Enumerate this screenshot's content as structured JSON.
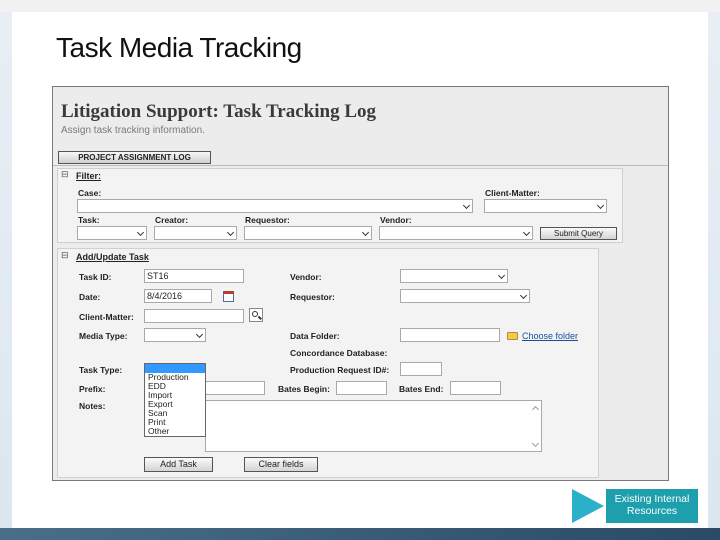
{
  "slide": {
    "title": "Task Media Tracking"
  },
  "app": {
    "title": "Litigation Support: Task Tracking Log",
    "subtitle": "Assign task tracking information.",
    "project_log_button": "PROJECT ASSIGNMENT LOG"
  },
  "filter": {
    "toggle": "⊟",
    "heading": "Filter:",
    "case_label": "Case:",
    "client_matter_label": "Client-Matter:",
    "task_label": "Task:",
    "creator_label": "Creator:",
    "requestor_label": "Requestor:",
    "vendor_label": "Vendor:",
    "submit_button": "Submit Query"
  },
  "task_form": {
    "toggle": "⊟",
    "heading": "Add/Update Task",
    "task_id_label": "Task ID:",
    "task_id_value": "ST16",
    "date_label": "Date:",
    "date_value": "8/4/2016",
    "client_matter_label": "Client-Matter:",
    "media_type_label": "Media Type:",
    "task_type_label": "Task Type:",
    "prefix_label": "Prefix:",
    "notes_label": "Notes:",
    "vendor_label": "Vendor:",
    "requestor_label": "Requestor:",
    "data_folder_label": "Data Folder:",
    "choose_folder_link": "Choose folder",
    "concordance_label": "Concordance Database:",
    "production_request_label": "Production Request ID#:",
    "bates_begin_label": "Bates Begin:",
    "bates_end_label": "Bates End:",
    "task_type_options": [
      "Production",
      "EDD",
      "Import",
      "Export",
      "Scan",
      "Print",
      "Other"
    ],
    "add_task_button": "Add Task",
    "clear_fields_button": "Clear fields"
  },
  "footer": {
    "resources_label": "Existing Internal Resources"
  },
  "colors": {
    "accent": "#1e9fae",
    "arrow": "#2ab0c8",
    "link": "#1a4fa0",
    "selection": "#3399ff"
  }
}
